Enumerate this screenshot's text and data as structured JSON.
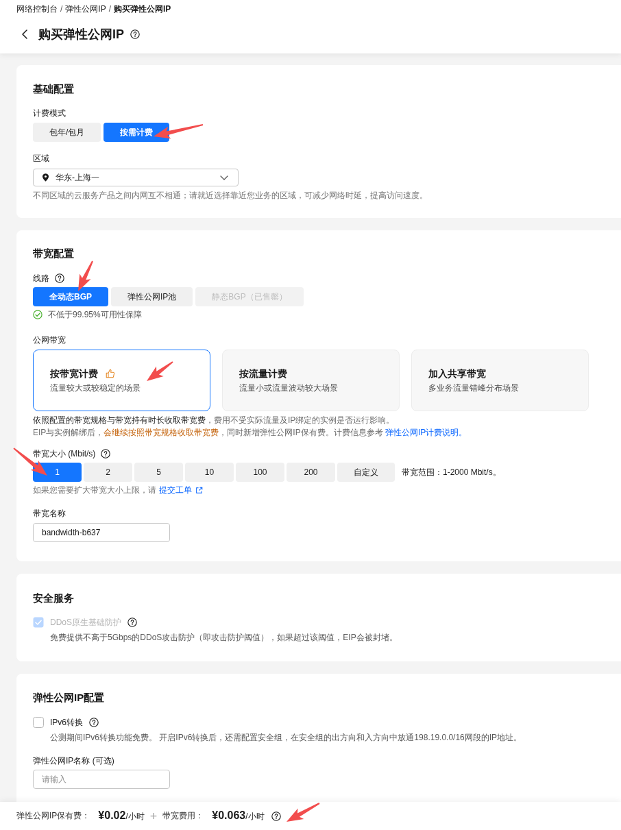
{
  "breadcrumb": {
    "items": [
      {
        "label": "网络控制台",
        "current": false
      },
      {
        "label": "弹性公网IP",
        "current": false
      },
      {
        "label": "购买弹性公网IP",
        "current": true
      }
    ],
    "separators": [
      "/",
      "/"
    ]
  },
  "page_title": "购买弹性公网IP",
  "basic": {
    "title": "基础配置",
    "billing": {
      "label": "计费模式",
      "options": [
        {
          "label": "包年/包月",
          "selected": false
        },
        {
          "label": "按需计费",
          "selected": true
        }
      ]
    },
    "region": {
      "label": "区域",
      "value": "华东-上海一",
      "hint": "不同区域的云服务产品之间内网互不相通；请就近选择靠近您业务的区域，可减少网络时延，提高访问速度。"
    }
  },
  "bandwidth": {
    "title": "带宽配置",
    "line": {
      "label": "线路",
      "options": [
        {
          "label": "全动态BGP",
          "selected": true,
          "disabled": false
        },
        {
          "label": "弹性公网IP池",
          "selected": false,
          "disabled": false
        },
        {
          "label": "静态BGP（已售罄）",
          "selected": false,
          "disabled": true
        }
      ],
      "guarantee": "不低于99.95%可用性保障"
    },
    "public_bandwidth": {
      "label": "公网带宽",
      "plans": [
        {
          "title": "按带宽计费",
          "description": "流量较大或较稳定的场景",
          "selected": true,
          "recommended": true
        },
        {
          "title": "按流量计费",
          "description": "流量小或流量波动较大场景",
          "selected": false,
          "recommended": false
        },
        {
          "title": "加入共享带宽",
          "description": "多业务流量错峰分布场景",
          "selected": false,
          "recommended": false
        }
      ],
      "notes": [
        [
          {
            "kind": "emphasis",
            "text": "依照配置的带宽规格与带宽持有时长收取带宽费"
          },
          {
            "kind": "plain",
            "text": "，费用不受实际流量及IP绑定的实例是否运行影响。"
          }
        ],
        [
          {
            "kind": "plain",
            "text": "EIP与实例解绑后，"
          },
          {
            "kind": "warning",
            "text": "会继续按照带宽规格收取带宽费"
          },
          {
            "kind": "plain",
            "text": "，同时新增弹性公网IP保有费。计费信息参考 "
          },
          {
            "kind": "link",
            "text": "弹性公网IP计费说明。"
          }
        ]
      ]
    },
    "size": {
      "label": "带宽大小 (Mbit/s)",
      "options": [
        {
          "label": "1",
          "selected": true
        },
        {
          "label": "2",
          "selected": false
        },
        {
          "label": "5",
          "selected": false
        },
        {
          "label": "10",
          "selected": false
        },
        {
          "label": "100",
          "selected": false
        },
        {
          "label": "200",
          "selected": false
        },
        {
          "label": "自定义",
          "selected": false
        }
      ],
      "range": "带宽范围：1-2000 Mbit/s。",
      "hint": "如果您需要扩大带宽大小上限，请",
      "hint_link": "提交工单"
    },
    "name": {
      "label": "带宽名称",
      "value": "bandwidth-b637"
    }
  },
  "security": {
    "title": "安全服务",
    "ddos": {
      "label": "DDoS原生基础防护",
      "checked": true,
      "disabled": true,
      "description": "免费提供不高于5Gbps的DDoS攻击防护（即攻击防护阈值），如果超过该阈值，EIP会被封堵。"
    }
  },
  "eip": {
    "title": "弹性公网IP配置",
    "ipv6": {
      "label": "IPv6转换",
      "checked": false,
      "disabled": false,
      "description": "公测期间IPv6转换功能免费。 开启IPv6转换后，还需配置安全组，在安全组的出方向和入方向中放通198.19.0.0/16网段的IP地址。"
    },
    "name": {
      "label": "弹性公网IP名称 (可选)",
      "placeholder": "请输入"
    }
  },
  "footer": {
    "fees": [
      {
        "label": "弹性公网IP保有费：",
        "price": "¥0.02",
        "unit": "/小时"
      },
      {
        "label": "带宽费用：",
        "price": "¥0.063",
        "unit": "/小时"
      }
    ],
    "separators": [
      "+"
    ]
  }
}
